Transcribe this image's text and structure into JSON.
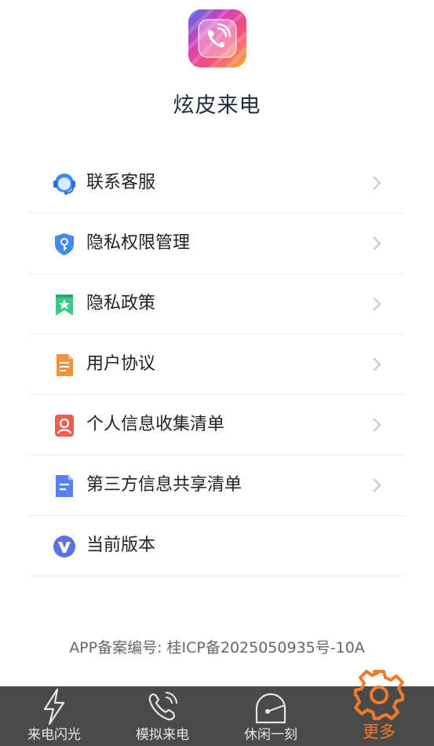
{
  "app": {
    "title": "炫皮来电"
  },
  "menu": {
    "items": [
      {
        "label": "联系客服",
        "icon": "customer-service-icon"
      },
      {
        "label": "隐私权限管理",
        "icon": "shield-key-icon"
      },
      {
        "label": "隐私政策",
        "icon": "bookmark-star-icon"
      },
      {
        "label": "用户协议",
        "icon": "document-icon"
      },
      {
        "label": "个人信息收集清单",
        "icon": "person-card-icon"
      },
      {
        "label": "第三方信息共享清单",
        "icon": "file-lines-icon"
      },
      {
        "label": "当前版本",
        "icon": "v-badge-icon"
      }
    ]
  },
  "footer": {
    "icp": "APP备案编号: 桂ICP备2025050935号-10A"
  },
  "tabs": [
    {
      "label": "来电闪光",
      "icon": "lightning-icon",
      "active": false
    },
    {
      "label": "模拟来电",
      "icon": "phone-ringing-icon",
      "active": false
    },
    {
      "label": "休闲一刻",
      "icon": "game-dial-icon",
      "active": false
    },
    {
      "label": "更多",
      "icon": "gear-icon",
      "active": true
    }
  ],
  "colors": {
    "accent": "#f47a2a",
    "tabbar_bg": "#4a4a4a",
    "title_text": "#1f2a3a"
  }
}
